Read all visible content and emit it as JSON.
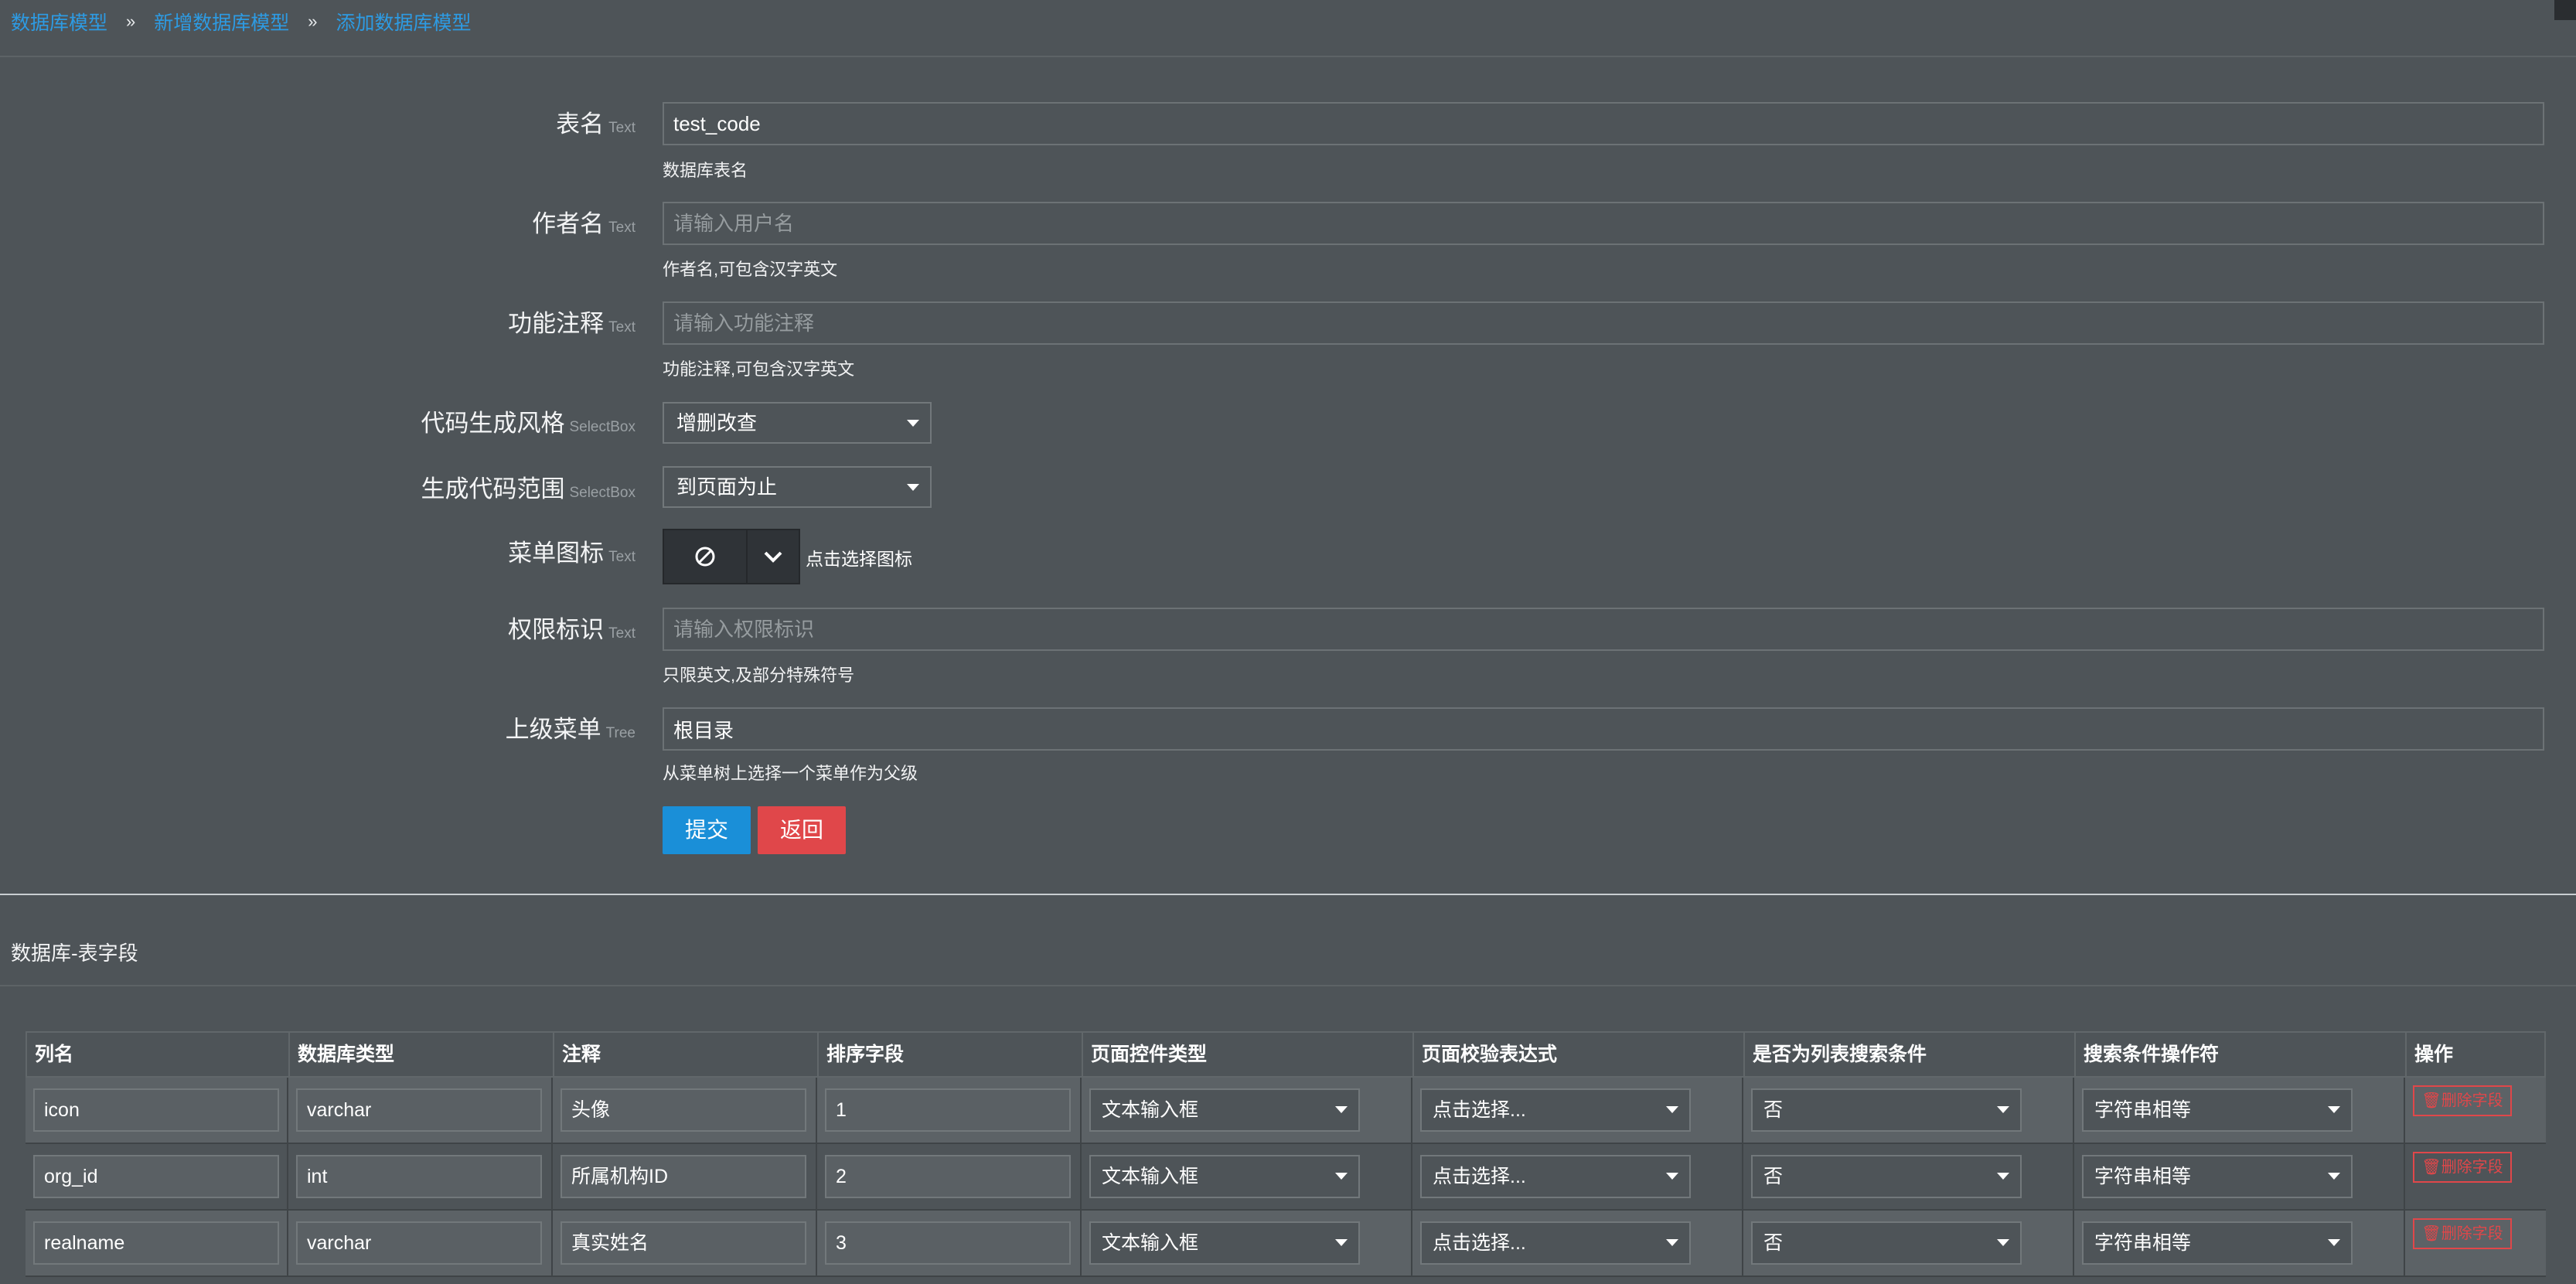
{
  "breadcrumb": [
    "数据库模型",
    "新增数据库模型",
    "添加数据库模型"
  ],
  "breadcrumb_sep": "»",
  "form": {
    "table_name": {
      "label": "表名",
      "type": "Text",
      "value": "test_code",
      "help": "数据库表名"
    },
    "author": {
      "label": "作者名",
      "type": "Text",
      "placeholder": "请输入用户名",
      "help": "作者名,可包含汉字英文"
    },
    "func_comment": {
      "label": "功能注释",
      "type": "Text",
      "placeholder": "请输入功能注释",
      "help": "功能注释,可包含汉字英文"
    },
    "code_style": {
      "label": "代码生成风格",
      "type": "SelectBox",
      "value": "增删改查"
    },
    "code_scope": {
      "label": "生成代码范围",
      "type": "SelectBox",
      "value": "到页面为止"
    },
    "menu_icon": {
      "label": "菜单图标",
      "type": "Text",
      "hint": "点击选择图标",
      "icon": "ban-icon"
    },
    "permission": {
      "label": "权限标识",
      "type": "Text",
      "placeholder": "请输入权限标识",
      "help": "只限英文,及部分特殊符号"
    },
    "parent_menu": {
      "label": "上级菜单",
      "type": "Tree",
      "value": "根目录",
      "help": "从菜单树上选择一个菜单作为父级"
    },
    "submit": "提交",
    "back": "返回"
  },
  "fields_section": {
    "title": "数据库-表字段",
    "headers": [
      "列名",
      "数据库类型",
      "注释",
      "排序字段",
      "页面控件类型",
      "页面校验表达式",
      "是否为列表搜索条件",
      "搜索条件操作符",
      "操作"
    ],
    "delete_label": "删除字段",
    "rows": [
      {
        "name": "icon",
        "db_type": "varchar",
        "comment": "头像",
        "sort": "1",
        "control": "文本输入框",
        "validate": "点击选择...",
        "searchable": "否",
        "operator": "字符串相等"
      },
      {
        "name": "org_id",
        "db_type": "int",
        "comment": "所属机构ID",
        "sort": "2",
        "control": "文本输入框",
        "validate": "点击选择...",
        "searchable": "否",
        "operator": "字符串相等"
      },
      {
        "name": "realname",
        "db_type": "varchar",
        "comment": "真实姓名",
        "sort": "3",
        "control": "文本输入框",
        "validate": "点击选择...",
        "searchable": "否",
        "operator": "字符串相等"
      }
    ]
  },
  "colors": {
    "accent": "#1a8fd8",
    "danger": "#e0474a",
    "background": "#4e5458"
  }
}
